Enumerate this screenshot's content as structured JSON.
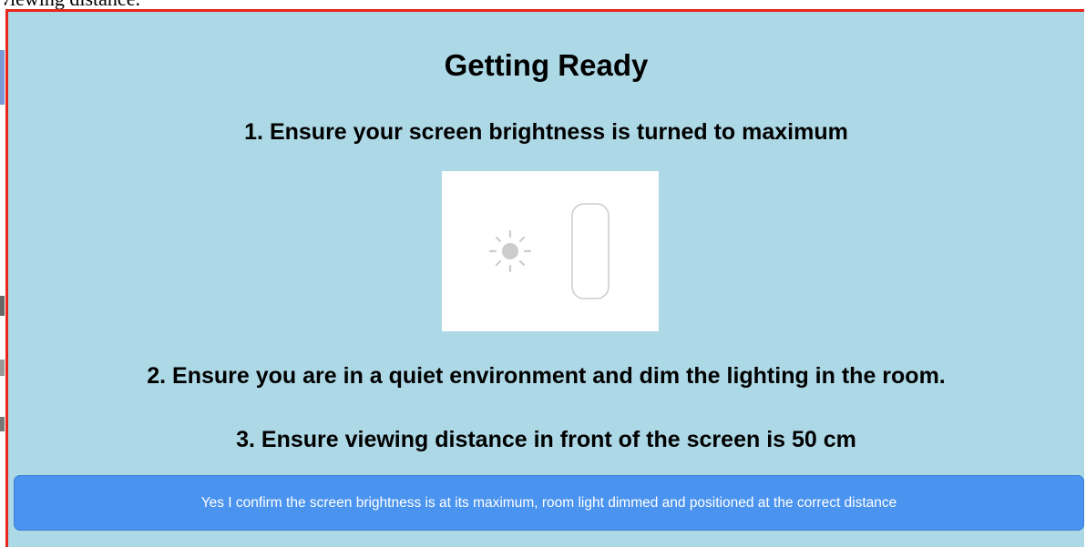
{
  "top_fragment": "viewing distance.",
  "panel": {
    "title": "Getting Ready",
    "steps": [
      "1. Ensure your screen brightness is turned to maximum",
      "2. Ensure you are in a quiet environment and dim the lighting in the room.",
      "3. Ensure viewing distance in front of the screen is 50 cm"
    ],
    "illustration": {
      "icons": [
        "sun-brightness-icon",
        "brightness-slider-icon"
      ]
    },
    "confirm_label": "Yes I confirm the screen brightness is at its maximum, room light dimmed and positioned at the correct distance"
  },
  "colors": {
    "panel_bg": "#add8e6",
    "border": "#e8271b",
    "button_bg": "#4a93ee",
    "button_text": "#ffffff"
  }
}
